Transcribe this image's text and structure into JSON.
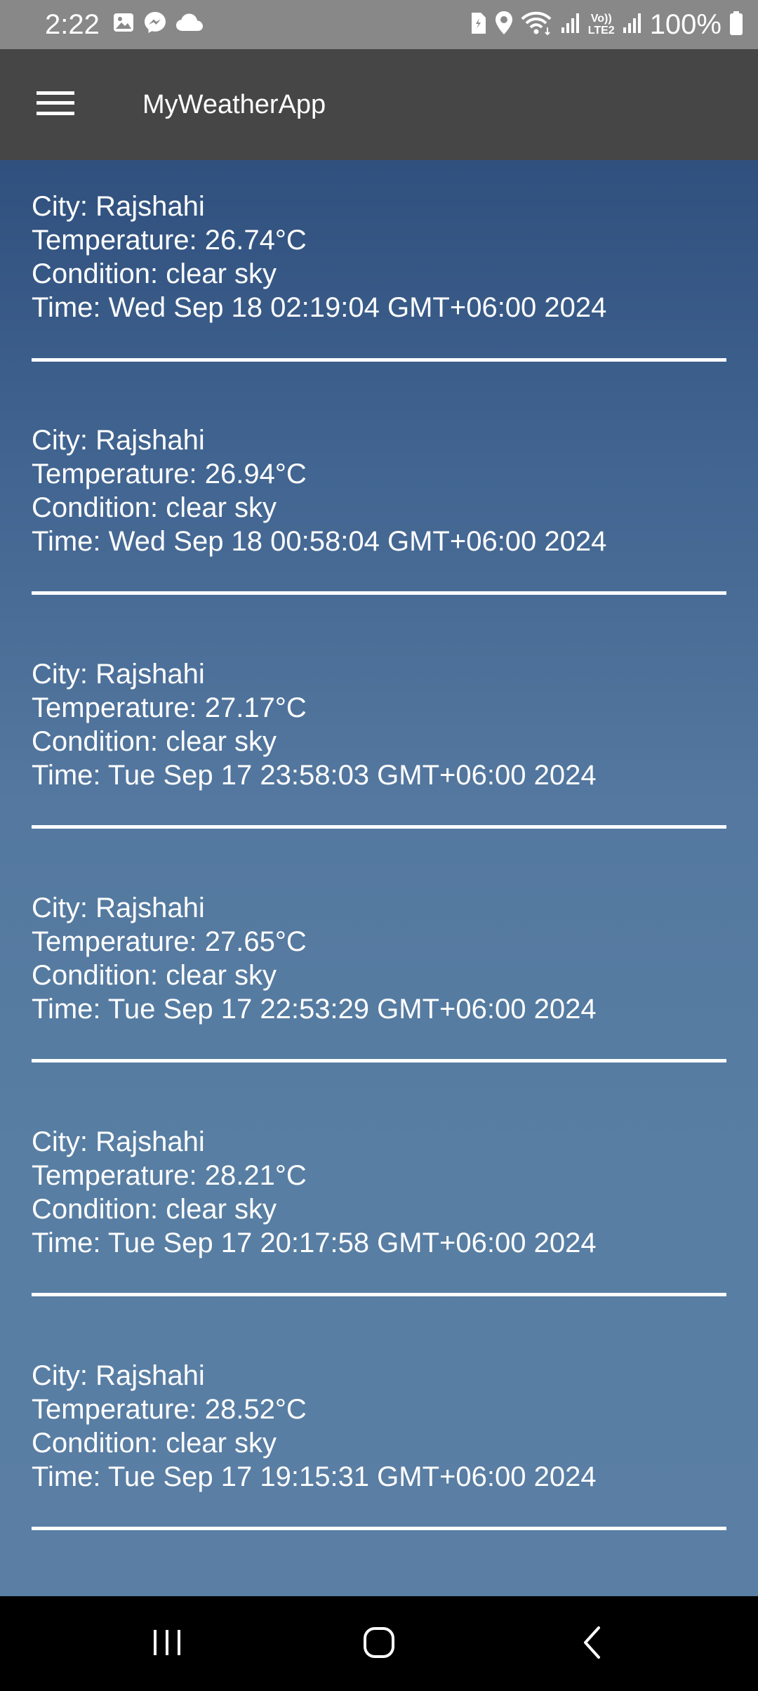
{
  "status_bar": {
    "time": "2:22",
    "battery": "100%",
    "icons_left": [
      "gallery-icon",
      "messenger-icon",
      "cloud-icon"
    ],
    "icons_right": [
      "sim-icon",
      "location-icon",
      "wifi-icon",
      "signal-icon",
      "volte-icon",
      "signal-icon",
      "battery-icon"
    ],
    "volte_label_top": "Vo))",
    "volte_label_bottom": "LTE2"
  },
  "app_bar": {
    "title": "MyWeatherApp",
    "menu_icon": "hamburger-menu-icon"
  },
  "entries": [
    {
      "city": "City: Rajshahi",
      "temperature": "Temperature: 26.74°C",
      "condition": "Condition: clear sky",
      "time": "Time: Wed Sep 18 02:19:04 GMT+06:00 2024"
    },
    {
      "city": "City: Rajshahi",
      "temperature": "Temperature: 26.94°C",
      "condition": "Condition: clear sky",
      "time": "Time: Wed Sep 18 00:58:04 GMT+06:00 2024"
    },
    {
      "city": "City: Rajshahi",
      "temperature": "Temperature: 27.17°C",
      "condition": "Condition: clear sky",
      "time": "Time: Tue Sep 17 23:58:03 GMT+06:00 2024"
    },
    {
      "city": "City: Rajshahi",
      "temperature": "Temperature: 27.65°C",
      "condition": "Condition: clear sky",
      "time": "Time: Tue Sep 17 22:53:29 GMT+06:00 2024"
    },
    {
      "city": "City: Rajshahi",
      "temperature": "Temperature: 28.21°C",
      "condition": "Condition: clear sky",
      "time": "Time: Tue Sep 17 20:17:58 GMT+06:00 2024"
    },
    {
      "city": "City: Rajshahi",
      "temperature": "Temperature: 28.52°C",
      "condition": "Condition: clear sky",
      "time": "Time: Tue Sep 17 19:15:31 GMT+06:00 2024"
    }
  ],
  "nav_bar": {
    "buttons": [
      "recents-icon",
      "home-icon",
      "back-icon"
    ]
  },
  "colors": {
    "status_bar": "#888888",
    "app_bar": "#464646",
    "content_top": "#30507e",
    "content_bottom": "#5a7ea4",
    "nav_bar": "#000000",
    "text": "#ffffff"
  }
}
